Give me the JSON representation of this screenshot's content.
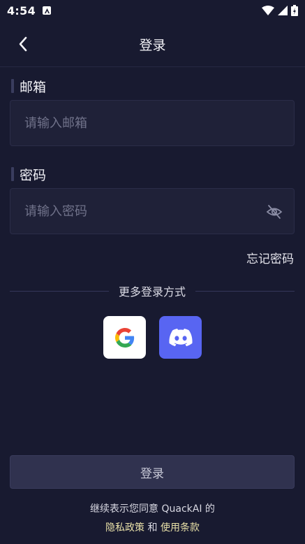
{
  "status_bar": {
    "time": "4:54"
  },
  "header": {
    "title": "登录"
  },
  "email": {
    "label": "邮箱",
    "placeholder": "请输入邮箱",
    "value": ""
  },
  "password": {
    "label": "密码",
    "placeholder": "请输入密码",
    "value": ""
  },
  "forgot_password": "忘记密码",
  "divider_text": "更多登录方式",
  "login_button": "登录",
  "agreement": {
    "prefix": "继续表示您同意 QuackAI 的",
    "privacy": "隐私政策",
    "and": "和",
    "terms": "使用条款"
  },
  "colors": {
    "background": "#181a30",
    "input_background": "#1f2138",
    "discord": "#5865f2",
    "link": "#e8e0a8"
  },
  "icons": [
    "back-arrow-icon",
    "eye-off-icon",
    "google-icon",
    "discord-icon",
    "wifi-icon",
    "signal-icon",
    "battery-icon"
  ]
}
